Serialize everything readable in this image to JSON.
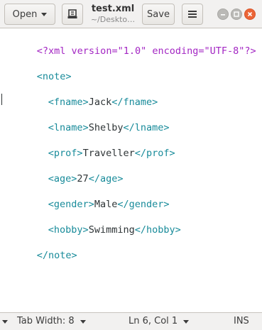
{
  "header": {
    "open_label": "Open",
    "title": "test.xml",
    "subtitle": "~/Deskto…",
    "save_label": "Save"
  },
  "editor": {
    "lines": [
      {
        "decl": "<?xml version=\"1.0\" encoding=\"UTF-8\"?>"
      },
      {
        "open": "<note>"
      },
      {
        "open": "<fname>",
        "text": "Jack",
        "close": "</fname>"
      },
      {
        "open": "<lname>",
        "text": "Shelby",
        "close": "</lname>"
      },
      {
        "open": "<prof>",
        "text": "Traveller",
        "close": "</prof>"
      },
      {
        "open": "<age>",
        "text": "27",
        "close": "</age>"
      },
      {
        "open": "<gender>",
        "text": "Male",
        "close": "</gender>"
      },
      {
        "open": "<hobby>",
        "text": "Swimming",
        "close": "</hobby>"
      },
      {
        "close": "</note>"
      }
    ]
  },
  "statusbar": {
    "tab_width": "Tab Width: 8",
    "position": "Ln 6, Col 1",
    "mode": "INS"
  },
  "colors": {
    "declaration": "#a326c3",
    "tag": "#188b9a",
    "text": "#2e3436",
    "close_button": "#eb6537"
  }
}
